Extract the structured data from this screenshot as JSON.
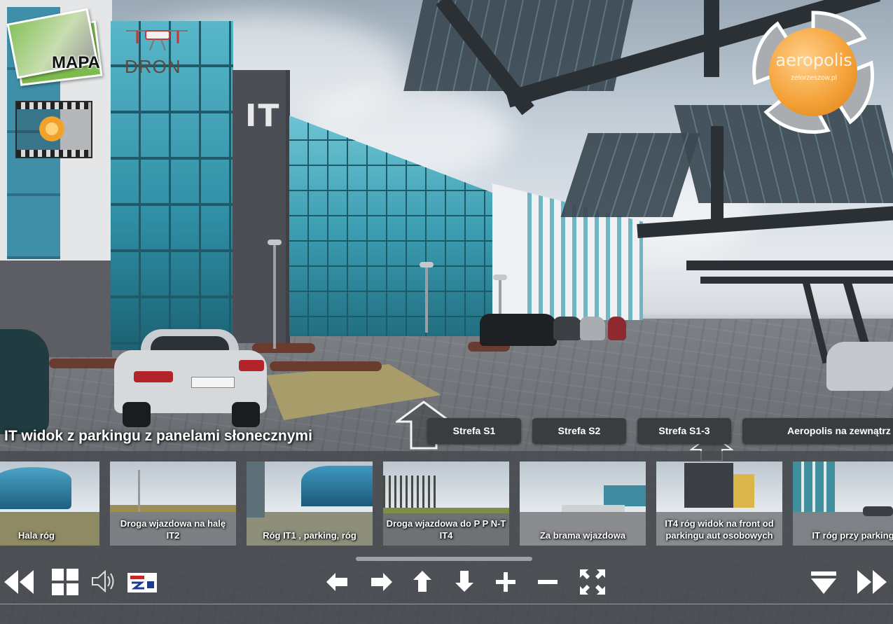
{
  "overlay": {
    "mapa_label": "MAPA",
    "dron_label": "DRON",
    "logo_name": "aeropolis",
    "logo_sub": "zetorzeszow.pl",
    "it_sign": "IT"
  },
  "scene_title": "IT widok z parkingu z panelami słonecznymi",
  "hotspots": [
    {
      "label": "Strefa S1"
    },
    {
      "label": "Strefa S2"
    },
    {
      "label": "Strefa S1-3"
    },
    {
      "label": "Aeropolis na zewnątrz"
    }
  ],
  "thumbnails": [
    {
      "label": "Hala róg"
    },
    {
      "label": "Droga wjazdowa na halę IT2"
    },
    {
      "label": "Róg IT1 , parking, róg"
    },
    {
      "label": "Droga wjazdowa do P P N-T IT4"
    },
    {
      "label": "Za brama wjazdowa"
    },
    {
      "label": "IT4 róg widok na front od parkingu aut osobowych"
    },
    {
      "label": "IT róg przy parkingu"
    }
  ],
  "controls": {
    "left": [
      "rewind-icon",
      "grid-icon",
      "speaker-icon",
      "zeto-logo"
    ],
    "center": [
      "arrow-left-icon",
      "arrow-right-icon",
      "arrow-up-icon",
      "arrow-down-icon",
      "zoom-in-icon",
      "zoom-out-icon",
      "fullscreen-icon"
    ],
    "right": [
      "hide-bar-icon",
      "fast-forward-icon"
    ]
  },
  "colors": {
    "button_bg": "#3a3d40",
    "bar_bg": "#464a4e",
    "logo_orange": "#f5a33a",
    "text": "#ffffff"
  }
}
